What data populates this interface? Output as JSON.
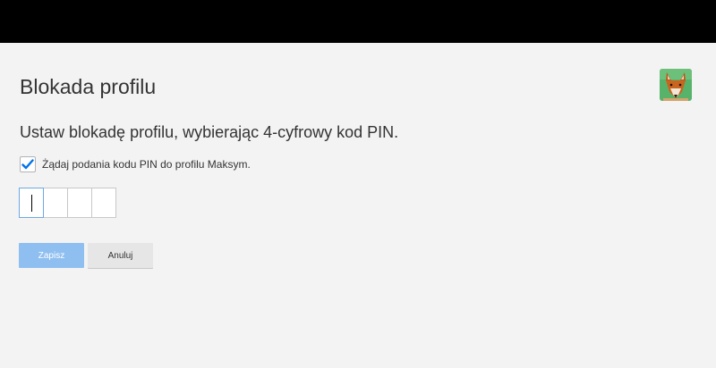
{
  "page": {
    "title": "Blokada profilu",
    "instruction": "Ustaw blokadę profilu, wybierając 4-cyfrowy kod PIN."
  },
  "profile": {
    "avatar_icon": "fox-avatar-icon"
  },
  "require_pin": {
    "label": "Żądaj podania kodu PIN do profilu Maksym.",
    "checked": true
  },
  "pin": {
    "digits": [
      "",
      "",
      "",
      ""
    ]
  },
  "buttons": {
    "save_label": "Zapisz",
    "cancel_label": "Anuluj"
  },
  "colors": {
    "background": "#f3f3f3",
    "top_bar": "#000000",
    "accent": "#0071eb",
    "save_button": "#8fbff0",
    "cancel_button": "#e6e6e6"
  }
}
